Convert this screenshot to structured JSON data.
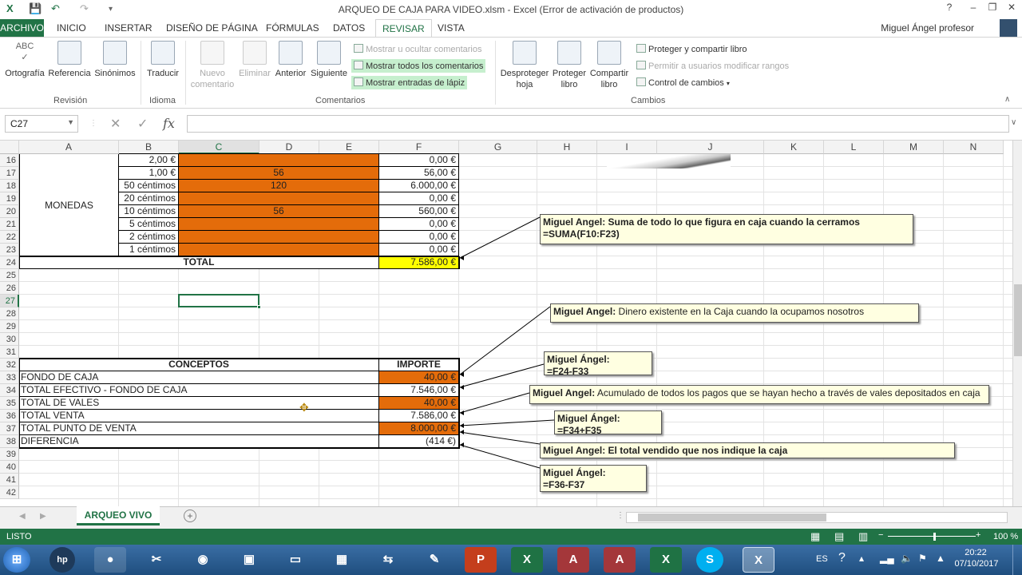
{
  "window": {
    "title": "ARQUEO DE CAJA PARA VIDEO.xlsm - Excel (Error de activación de productos)",
    "user": "Miguel Ángel profesor",
    "controls": [
      "?",
      "–",
      "❐",
      "✕"
    ]
  },
  "tabs": [
    "ARCHIVO",
    "INICIO",
    "INSERTAR",
    "DISEÑO DE PÁGINA",
    "FÓRMULAS",
    "DATOS",
    "REVISAR",
    "VISTA"
  ],
  "ribbon": {
    "revision": {
      "label": "Revisión",
      "ortografia": "Ortografía",
      "referencia": "Referencia",
      "sinonimos": "Sinónimos",
      "abc": "ABC"
    },
    "idioma": {
      "label": "Idioma",
      "traducir": "Traducir"
    },
    "comentarios": {
      "label": "Comentarios",
      "nuevo1": "Nuevo",
      "nuevo2": "comentario",
      "eliminar": "Eliminar",
      "anterior": "Anterior",
      "siguiente": "Siguiente",
      "mostrar_ocultar": "Mostrar u ocultar comentarios",
      "mostrar_todos": "Mostrar todos los comentarios",
      "mostrar_lapiz": "Mostrar entradas de lápiz"
    },
    "cambios": {
      "label": "Cambios",
      "desproteger1": "Desproteger",
      "desproteger2": "hoja",
      "proteger1": "Proteger",
      "proteger2": "libro",
      "compartir1": "Compartir",
      "compartir2": "libro",
      "proteger_compartir": "Proteger y compartir libro",
      "permitir": "Permitir a usuarios modificar rangos",
      "control": "Control de cambios"
    }
  },
  "formula_bar": {
    "name_box": "C27",
    "fx": "fx",
    "value": ""
  },
  "columns": [
    "A",
    "B",
    "C",
    "D",
    "E",
    "F",
    "G",
    "H",
    "I",
    "J",
    "K",
    "L",
    "M",
    "N"
  ],
  "rows": [
    "16",
    "17",
    "18",
    "19",
    "20",
    "21",
    "22",
    "23",
    "24",
    "25",
    "26",
    "27",
    "28",
    "29",
    "30",
    "31",
    "32",
    "33",
    "34",
    "35",
    "36",
    "37",
    "38",
    "39",
    "40",
    "41",
    "42"
  ],
  "monedas": {
    "label": "MONEDAS",
    "items": [
      {
        "name": "2,00 €",
        "qty": "",
        "amount": "0,00 €"
      },
      {
        "name": "1,00 €",
        "qty": "56",
        "amount": "56,00 €"
      },
      {
        "name": "50 céntimos",
        "qty": "120",
        "amount": "6.000,00 €"
      },
      {
        "name": "20 céntimos",
        "qty": "",
        "amount": "0,00 €"
      },
      {
        "name": "10 céntimos",
        "qty": "56",
        "amount": "560,00 €"
      },
      {
        "name": "5 céntimos",
        "qty": "",
        "amount": "0,00 €"
      },
      {
        "name": "2 céntimos",
        "qty": "",
        "amount": "0,00 €"
      },
      {
        "name": "1 céntimos",
        "qty": "",
        "amount": "0,00 €"
      }
    ],
    "total_label": "TOTAL",
    "total_value": "7.586,00 €"
  },
  "conceptos": {
    "header_concept": "CONCEPTOS",
    "header_amount": "IMPORTE",
    "rows": [
      {
        "label": "FONDO DE CAJA",
        "value": "40,00 €"
      },
      {
        "label": "TOTAL EFECTIVO - FONDO DE CAJA",
        "value": "7.546,00 €"
      },
      {
        "label": "TOTAL DE VALES",
        "value": "40,00 €"
      },
      {
        "label": "TOTAL VENTA",
        "value": "7.586,00 €"
      },
      {
        "label": "TOTAL PUNTO DE VENTA",
        "value": "8.000,00 €"
      },
      {
        "label": "DIFERENCIA",
        "value": "(414 €)"
      }
    ]
  },
  "comments": [
    {
      "author": "Miguel Angel:",
      "text": " Suma de todo lo que figura en caja cuando la cerramos",
      "text_bold": true,
      "line2": "=SUMA(F10:F23)"
    },
    {
      "author": "Miguel Angel:",
      "text": " Dinero existente en la Caja cuando la ocupamos nosotros",
      "text_bold": false,
      "line2": ""
    },
    {
      "author": "Miguel Ángel:",
      "text": "",
      "text_bold": true,
      "line2": "=F24-F33"
    },
    {
      "author": "Miguel Angel:",
      "text": " Acumulado de todos los pagos que se hayan hecho a través de vales depositados en caja",
      "text_bold": false,
      "line2": ""
    },
    {
      "author": "Miguel Ángel:",
      "text": "",
      "text_bold": true,
      "line2": "=F34+F35"
    },
    {
      "author": "Miguel Angel:",
      "text": " El total vendido que nos indique la caja",
      "text_bold": true,
      "line2": ""
    },
    {
      "author": "Miguel Ángel:",
      "text": "",
      "text_bold": true,
      "line2": "=F36-F37"
    }
  ],
  "sheet": {
    "tab": "ARQUEO VIVO"
  },
  "status": {
    "ready": "LISTO",
    "zoom": "100 %"
  },
  "taskbar": {
    "lang": "ES",
    "time": "20:22",
    "date": "07/10/2017"
  }
}
